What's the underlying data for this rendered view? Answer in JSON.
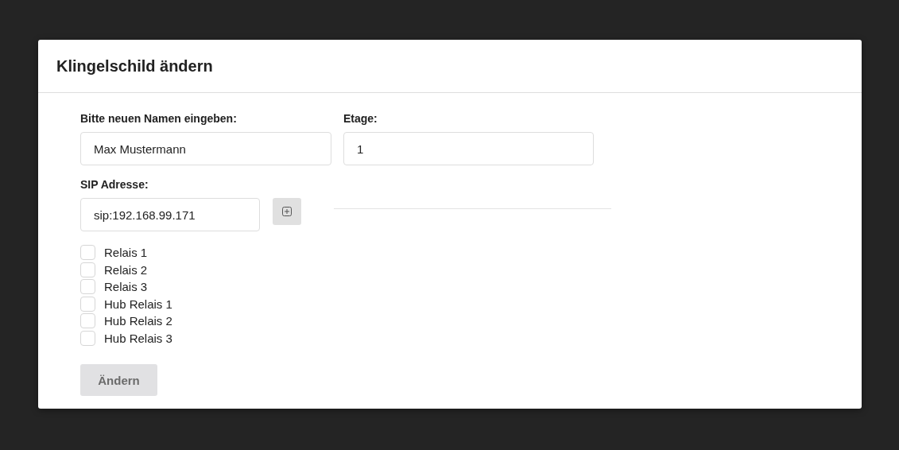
{
  "dialog": {
    "title": "Klingelschild ändern"
  },
  "name_field": {
    "label": "Bitte neuen Namen eingeben:",
    "value": "Max Mustermann"
  },
  "floor_field": {
    "label": "Etage:",
    "value": "1"
  },
  "sip_field": {
    "label": "SIP Adresse:",
    "value": "sip:192.168.99.171"
  },
  "relays": [
    {
      "label": "Relais 1",
      "checked": false
    },
    {
      "label": "Relais 2",
      "checked": false
    },
    {
      "label": "Relais 3",
      "checked": false
    },
    {
      "label": "Hub Relais 1",
      "checked": false
    },
    {
      "label": "Hub Relais 2",
      "checked": false
    },
    {
      "label": "Hub Relais 3",
      "checked": false
    }
  ],
  "submit_button": {
    "label": "Ändern",
    "disabled": true
  }
}
